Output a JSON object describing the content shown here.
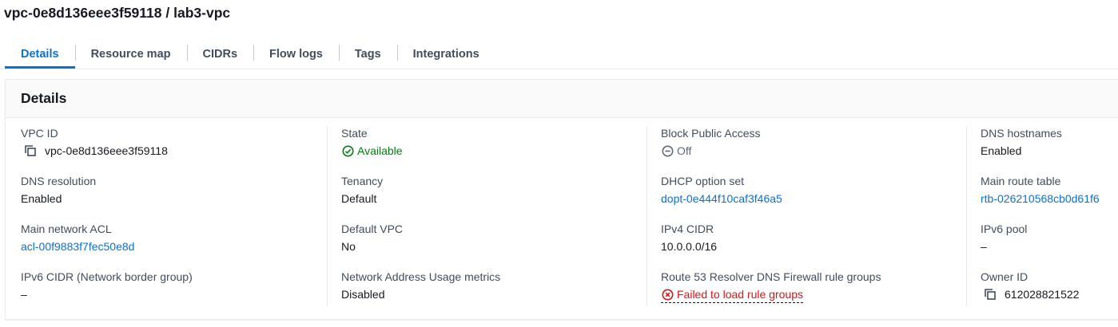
{
  "page": {
    "title": "vpc-0e8d136eee3f59118 / lab3-vpc"
  },
  "tabs": [
    {
      "label": "Details",
      "active": true
    },
    {
      "label": "Resource map",
      "active": false
    },
    {
      "label": "CIDRs",
      "active": false
    },
    {
      "label": "Flow logs",
      "active": false
    },
    {
      "label": "Tags",
      "active": false
    },
    {
      "label": "Integrations",
      "active": false
    }
  ],
  "details": {
    "heading": "Details",
    "col1": {
      "vpc_id_label": "VPC ID",
      "vpc_id_value": "vpc-0e8d136eee3f59118",
      "dns_resolution_label": "DNS resolution",
      "dns_resolution_value": "Enabled",
      "main_acl_label": "Main network ACL",
      "main_acl_value": "acl-00f9883f7fec50e8d",
      "ipv6_cidr_label": "IPv6 CIDR (Network border group)",
      "ipv6_cidr_value": "–"
    },
    "col2": {
      "state_label": "State",
      "state_value": "Available",
      "tenancy_label": "Tenancy",
      "tenancy_value": "Default",
      "default_vpc_label": "Default VPC",
      "default_vpc_value": "No",
      "nau_metrics_label": "Network Address Usage metrics",
      "nau_metrics_value": "Disabled"
    },
    "col3": {
      "bpa_label": "Block Public Access",
      "bpa_value": "Off",
      "dhcp_label": "DHCP option set",
      "dhcp_value": "dopt-0e444f10caf3f46a5",
      "ipv4_cidr_label": "IPv4 CIDR",
      "ipv4_cidr_value": "10.0.0.0/16",
      "r53_label": "Route 53 Resolver DNS Firewall rule groups",
      "r53_value": "Failed to load rule groups"
    },
    "col4": {
      "dns_hostnames_label": "DNS hostnames",
      "dns_hostnames_value": "Enabled",
      "main_rt_label": "Main route table",
      "main_rt_value": "rtb-026210568cb0d61f6",
      "ipv6_pool_label": "IPv6 pool",
      "ipv6_pool_value": "–",
      "owner_label": "Owner ID",
      "owner_value": "612028821522"
    }
  },
  "colors": {
    "link": "#0972d3",
    "success": "#037f0c",
    "error": "#d91515",
    "muted": "#5f6b7a"
  },
  "icons": {
    "copy": "copy-icon",
    "available": "status-success-icon",
    "off": "status-stopped-icon",
    "error": "status-error-icon"
  }
}
